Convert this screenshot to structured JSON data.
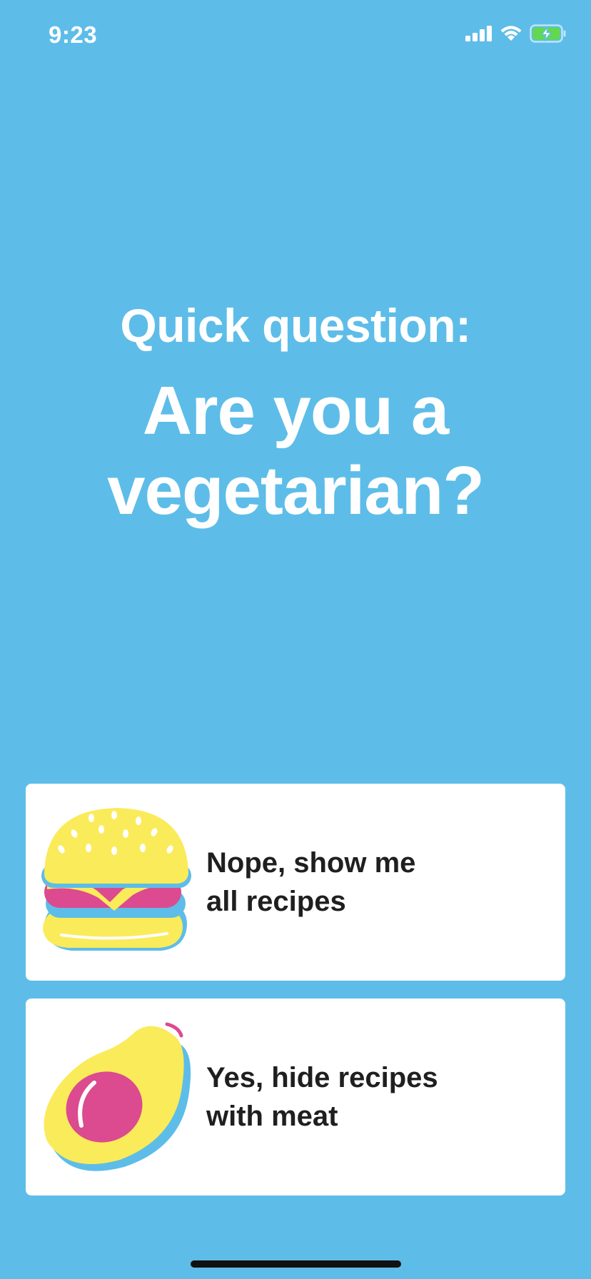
{
  "status_bar": {
    "time": "9:23",
    "icons": [
      "cellular-signal-icon",
      "wifi-icon",
      "battery-charging-icon"
    ],
    "battery_color": "#62D84E"
  },
  "prompt": {
    "kicker": "Quick question:",
    "question": "Are you a\nvegetarian?"
  },
  "options": [
    {
      "label": "Nope, show me\nall recipes",
      "icon": "burger-icon"
    },
    {
      "label": "Yes, hide recipes\nwith meat",
      "icon": "avocado-icon"
    }
  ],
  "colors": {
    "background": "#5DBDE8",
    "card": "#FFFFFF",
    "text_primary": "#1F1F1F",
    "illustration_yellow": "#FAEB5A",
    "illustration_pink": "#DC4A8F",
    "illustration_blue": "#5DBDE8"
  }
}
